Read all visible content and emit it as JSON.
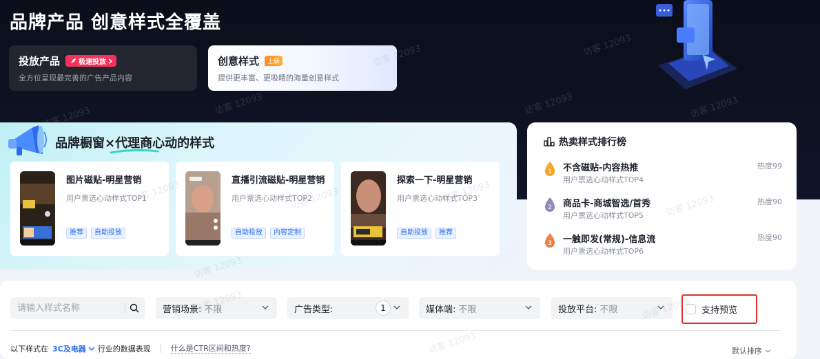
{
  "hero": {
    "title": "品牌产品 创意样式全覆盖",
    "tabs": [
      {
        "title": "投放产品",
        "badge": "极速投放",
        "desc": "全方位呈现最完善的广告产品内容"
      },
      {
        "title": "创意样式",
        "badge": "上新",
        "desc": "提供更丰富、更吸睛的海量创意样式"
      }
    ]
  },
  "watermark": "访客 12093",
  "brand": {
    "title": "品牌橱窗×代理商心动的样式",
    "cards": [
      {
        "title": "图片磁贴-明星营销",
        "subtitle": "用户票选心动样式TOP1",
        "tags": [
          "推荐",
          "自助投放"
        ]
      },
      {
        "title": "直播引流磁贴-明星营销",
        "subtitle": "用户票选心动样式TOP2",
        "tags": [
          "自助投放",
          "内容定制"
        ]
      },
      {
        "title": "探索一下-明星营销",
        "subtitle": "用户票选心动样式TOP3",
        "tags": [
          "自助投放",
          "推荐"
        ]
      }
    ]
  },
  "ranking": {
    "title": "热卖样式排行榜",
    "items": [
      {
        "rank": "1",
        "name": "不含磁贴-内容热推",
        "subtitle": "用户票选心动样式TOP4",
        "heat": "热度99",
        "color": "#f5a623"
      },
      {
        "rank": "2",
        "name": "商品卡-商城智选/首秀",
        "subtitle": "用户票选心动样式TOP5",
        "heat": "热度90",
        "color": "#8f8bb8"
      },
      {
        "rank": "3",
        "name": "一触即发(常规)-信息流",
        "subtitle": "用户票选心动样式TOP6",
        "heat": "热度90",
        "color": "#e8824a"
      }
    ]
  },
  "filters": {
    "search_placeholder": "请输入样式名称",
    "scene_label": "营销场景:",
    "scene_value": "不限",
    "adtype_label": "广告类型:",
    "adtype_count": "1",
    "media_label": "媒体端:",
    "media_value": "不限",
    "platform_label": "投放平台:",
    "platform_value": "不限",
    "preview_label": "支持预览"
  },
  "footer": {
    "prefix": "以下样式在",
    "industry": "3C及电器",
    "suffix": "行业的数据表现",
    "ctr_link": "什么是CTR区间和热度?",
    "sort": "默认排序"
  },
  "colors": {
    "accent": "#2a6cf0",
    "badge_red": "#f5325c",
    "highlight_border": "#e0302e"
  }
}
